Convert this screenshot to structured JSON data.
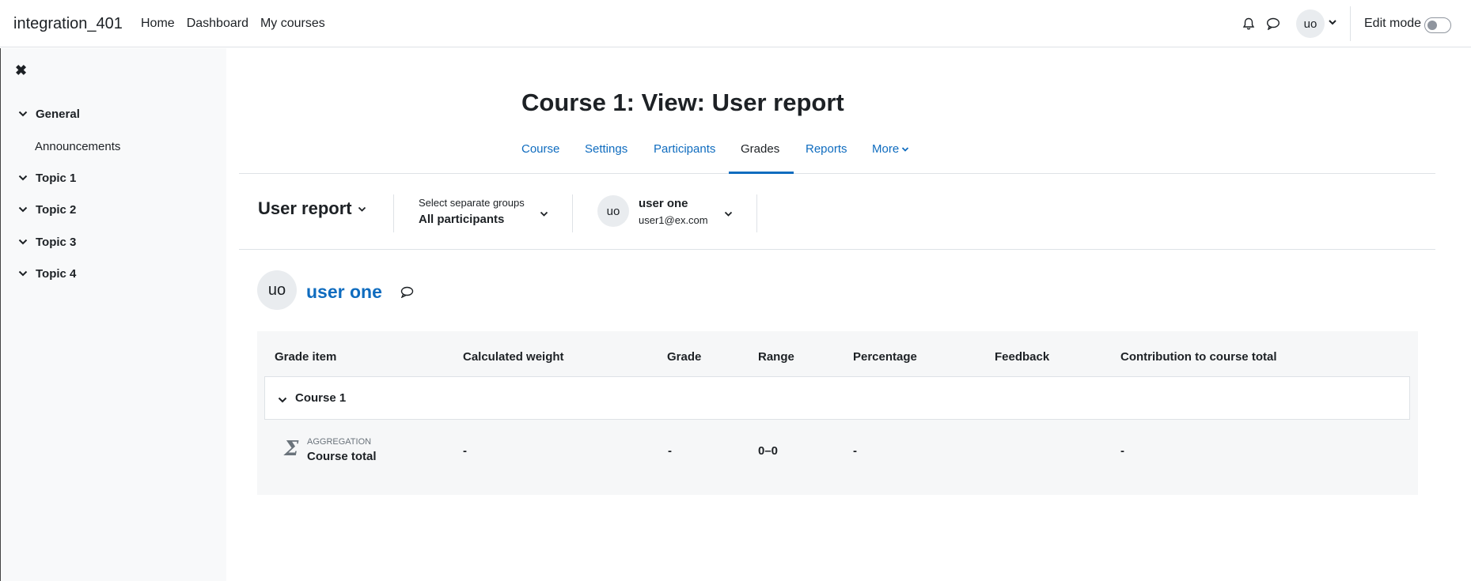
{
  "navbar": {
    "brand": "integration_401",
    "links": [
      "Home",
      "Dashboard",
      "My courses"
    ],
    "avatar_initials": "uo",
    "edit_mode_label": "Edit mode"
  },
  "drawer": {
    "sections": [
      {
        "label": "General",
        "items": [
          "Announcements"
        ]
      },
      {
        "label": "Topic 1"
      },
      {
        "label": "Topic 2"
      },
      {
        "label": "Topic 3"
      },
      {
        "label": "Topic 4"
      }
    ]
  },
  "page": {
    "title": "Course 1: View: User report"
  },
  "secondary_nav": {
    "tabs": [
      "Course",
      "Settings",
      "Participants",
      "Grades",
      "Reports",
      "More"
    ],
    "active": "Grades"
  },
  "tertiary": {
    "report_label": "User report",
    "group_label": "Select separate groups",
    "group_value": "All participants",
    "user_initials": "uo",
    "user_name": "user one",
    "user_email": "user1@ex.com"
  },
  "user": {
    "initials": "uo",
    "name": "user one"
  },
  "grade_table": {
    "headers": [
      "Grade item",
      "Calculated weight",
      "Grade",
      "Range",
      "Percentage",
      "Feedback",
      "Contribution to course total"
    ],
    "category": "Course 1",
    "total_row": {
      "type_label": "AGGREGATION",
      "name": "Course total",
      "weight": "-",
      "grade": "-",
      "range": "0–0",
      "percentage": "-",
      "feedback": "",
      "contribution": "-"
    }
  },
  "colors": {
    "link": "#0f6cbf",
    "text": "#1d2125",
    "drawer_bg": "#f8f9fa",
    "table_bg": "#f6f7f8"
  }
}
